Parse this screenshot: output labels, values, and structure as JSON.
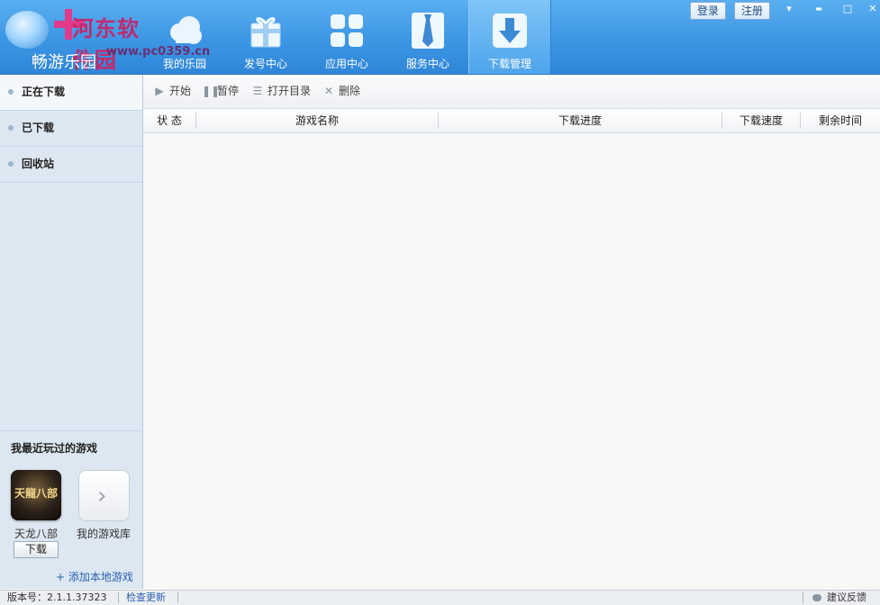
{
  "header": {
    "app_title": "畅游乐园",
    "watermark_text": "河东软件园",
    "watermark_url": "www.pc0359.cn",
    "login_label": "登录",
    "register_label": "注册",
    "minimize_glyph": "▬",
    "maximize_glyph": "□",
    "close_glyph": "✕",
    "menu_glyph": "▾",
    "nav": [
      {
        "label": "我的乐园",
        "icon": "cloud-icon"
      },
      {
        "label": "发号中心",
        "icon": "gift-icon"
      },
      {
        "label": "应用中心",
        "icon": "apps-grid-icon"
      },
      {
        "label": "服务中心",
        "icon": "tie-icon"
      },
      {
        "label": "下载管理",
        "icon": "download-icon",
        "active": true
      }
    ]
  },
  "sidebar": {
    "items": [
      {
        "label": "正在下载",
        "active": true
      },
      {
        "label": "已下载"
      },
      {
        "label": "回收站"
      }
    ],
    "recent_title": "我最近玩过的游戏",
    "game": {
      "name": "天龙八部",
      "tile_text": "天龍八部",
      "button": "下载"
    },
    "library_label": "我的游戏库",
    "add_local": "+ 添加本地游戏"
  },
  "toolbar": {
    "start": "开始",
    "pause": "暂停",
    "open_dir": "打开目录",
    "delete": "删除"
  },
  "table": {
    "columns": [
      "状 态",
      "游戏名称",
      "下载进度",
      "下载速度",
      "剩余时间"
    ],
    "rows": []
  },
  "status": {
    "version": "版本号：2.1.1.37323",
    "check_update": "检查更新",
    "feedback": "建议反馈"
  },
  "colors": {
    "header_blue": "#3d96e4",
    "sidebar_bg": "#dde7f1",
    "link_blue": "#2a62b0"
  }
}
